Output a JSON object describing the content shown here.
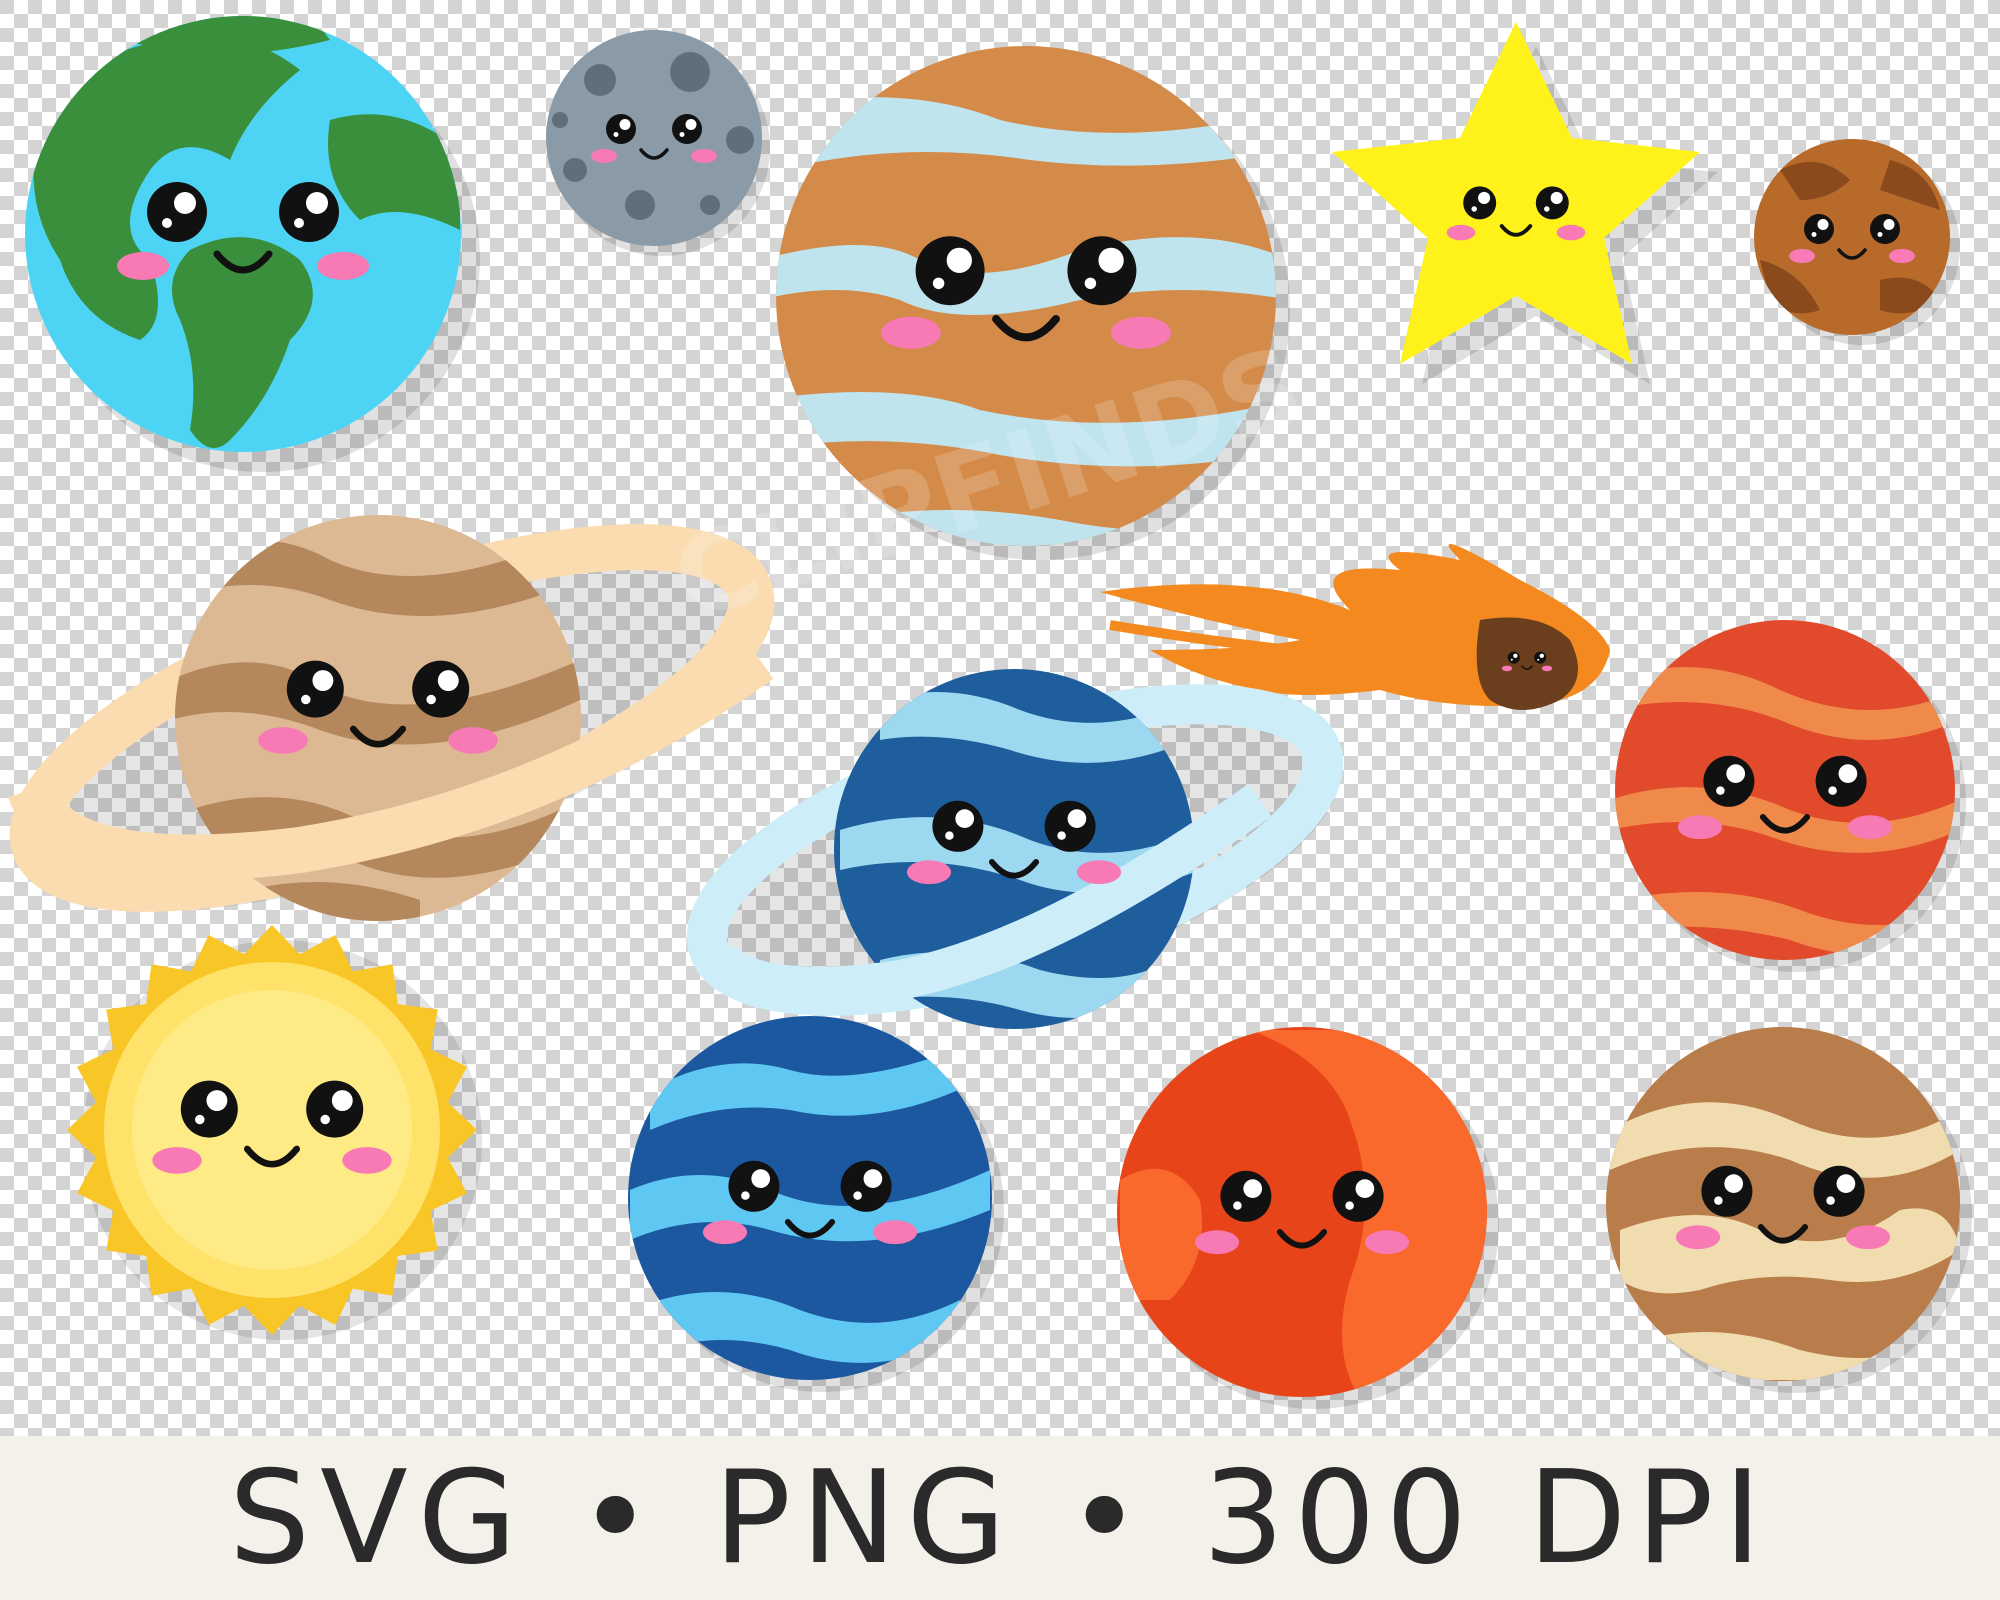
{
  "watermark": "CLIPFINDS",
  "footer": {
    "text": "SVG • PNG • 300 DPI"
  },
  "colors": {
    "checker_light": "#ffffff",
    "checker_dark": "#d2d2d2",
    "blush": "#f77ab4",
    "eye": "#111111",
    "footer_bg": "#f4f1ea"
  },
  "items": [
    {
      "name": "earth",
      "colors": [
        "#4dd4f4",
        "#3a8f3c"
      ]
    },
    {
      "name": "moon",
      "colors": [
        "#8a9aa6",
        "#5f6e79"
      ]
    },
    {
      "name": "jupiter",
      "colors": [
        "#d48a48",
        "#bfe4ee"
      ]
    },
    {
      "name": "star",
      "colors": [
        "#fff21a",
        "#e7d000"
      ]
    },
    {
      "name": "mercury",
      "colors": [
        "#b86a2a",
        "#8a4a1c"
      ]
    },
    {
      "name": "saturn",
      "colors": [
        "#dcb992",
        "#b4875d",
        "#fbdcb0"
      ]
    },
    {
      "name": "comet",
      "colors": [
        "#f48a1f",
        "#6b3e1e"
      ]
    },
    {
      "name": "uranus",
      "colors": [
        "#1e5e9c",
        "#9cd8f0",
        "#cdeef9"
      ]
    },
    {
      "name": "red-planet",
      "colors": [
        "#e14b2b",
        "#f08a4a"
      ]
    },
    {
      "name": "sun",
      "colors": [
        "#ffe26a",
        "#f8c626"
      ]
    },
    {
      "name": "neptune",
      "colors": [
        "#1b58a0",
        "#5fc8f2"
      ]
    },
    {
      "name": "mars",
      "colors": [
        "#e8441a",
        "#f9692b"
      ]
    },
    {
      "name": "venus",
      "colors": [
        "#b87d4a",
        "#f0dcaf"
      ]
    }
  ]
}
